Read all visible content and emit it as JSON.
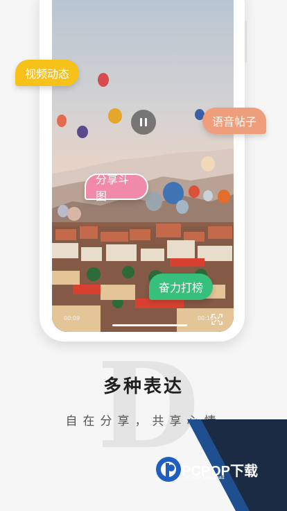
{
  "tags": {
    "video": "视频动态",
    "voice": "语音帖子",
    "meme": "分享斗图",
    "fight": "奋力打榜"
  },
  "player": {
    "time_current": "00:09",
    "time_total": "00:16",
    "controls": [
      "pause-icon",
      "fullscreen-icon"
    ]
  },
  "headline": "多种表达",
  "subheadline": "自在分享，共享心情",
  "watermark_letter": "D",
  "logo": {
    "name": "PCPOP下载",
    "tagline": "PCPOP Download"
  },
  "colors": {
    "video_tag": "#f6c21a",
    "voice_tag": "#ef9e7b",
    "meme_tag": "#f08aa6",
    "fight_tag": "#36c07c",
    "logo_blue": "#1f5fbf",
    "corner_dark": "#1b2b44"
  }
}
